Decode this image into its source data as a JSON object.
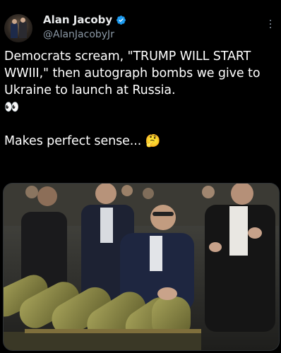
{
  "author": {
    "display_name": "Alan Jacoby",
    "handle": "@AlanJacobyJr",
    "verified": true
  },
  "tweet": {
    "line1": "Democrats scream, \"TRUMP WILL START WWIII,\" then autograph bombs we give to Ukraine to launch at Russia.",
    "eyes_emoji": "👀",
    "line2": "Makes perfect sense...",
    "thinking_emoji": "🤔"
  },
  "colors": {
    "background": "#000000",
    "text": "#ffffff",
    "secondary": "#8b98a5",
    "verified_blue": "#1d9bf0"
  },
  "icons": {
    "verified": "verified-badge-icon",
    "more": "more-options-icon"
  }
}
